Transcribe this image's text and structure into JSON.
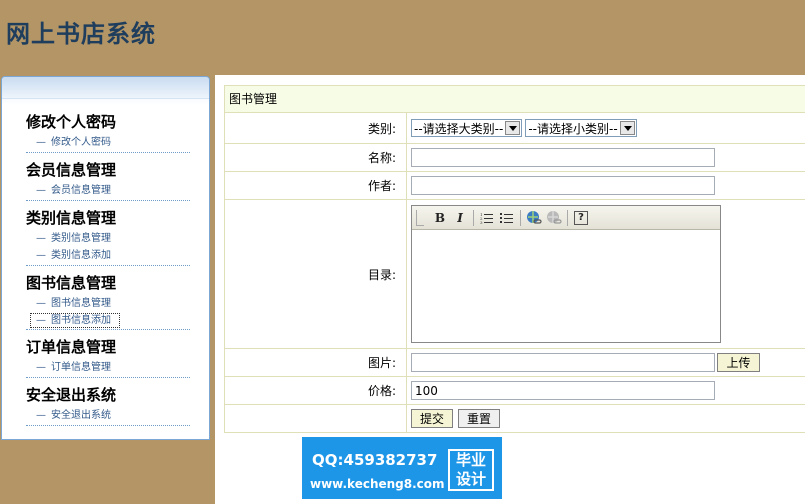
{
  "app": {
    "title": "网上书店系统"
  },
  "sidebar": {
    "groups": [
      {
        "title": "修改个人密码",
        "items": [
          {
            "label": "修改个人密码"
          }
        ]
      },
      {
        "title": "会员信息管理",
        "items": [
          {
            "label": "会员信息管理"
          }
        ]
      },
      {
        "title": "类别信息管理",
        "items": [
          {
            "label": "类别信息管理"
          },
          {
            "label": "类别信息添加"
          }
        ]
      },
      {
        "title": "图书信息管理",
        "items": [
          {
            "label": "图书信息管理"
          },
          {
            "label": "图书信息添加"
          }
        ]
      },
      {
        "title": "订单信息管理",
        "items": [
          {
            "label": "订单信息管理"
          }
        ]
      },
      {
        "title": "安全退出系统",
        "items": [
          {
            "label": "安全退出系统"
          }
        ]
      }
    ],
    "item_prefix": "—"
  },
  "form": {
    "caption": "图书管理",
    "category_label": "类别:",
    "category_major_placeholder": "--请选择大类别--",
    "category_minor_placeholder": "--请选择小类别--",
    "name_label": "名称:",
    "name_value": "",
    "author_label": "作者:",
    "author_value": "",
    "toc_label": "目录:",
    "image_label": "图片:",
    "image_value": "",
    "upload_button": "上传",
    "price_label": "价格:",
    "price_value": "100",
    "submit_button": "提交",
    "reset_button": "重置"
  },
  "editor_toolbar": {
    "bold": "B",
    "italic": "I",
    "help": "?"
  },
  "watermark": {
    "qq": "QQ:459382737",
    "url": "www.kecheng8.com",
    "badge_line1": "毕业",
    "badge_line2": "设计"
  },
  "colors": {
    "page_background": "#b39566",
    "title_text": "#1f3d5c",
    "form_border": "#e0e0b8",
    "watermark_bg": "#1e96e8"
  }
}
